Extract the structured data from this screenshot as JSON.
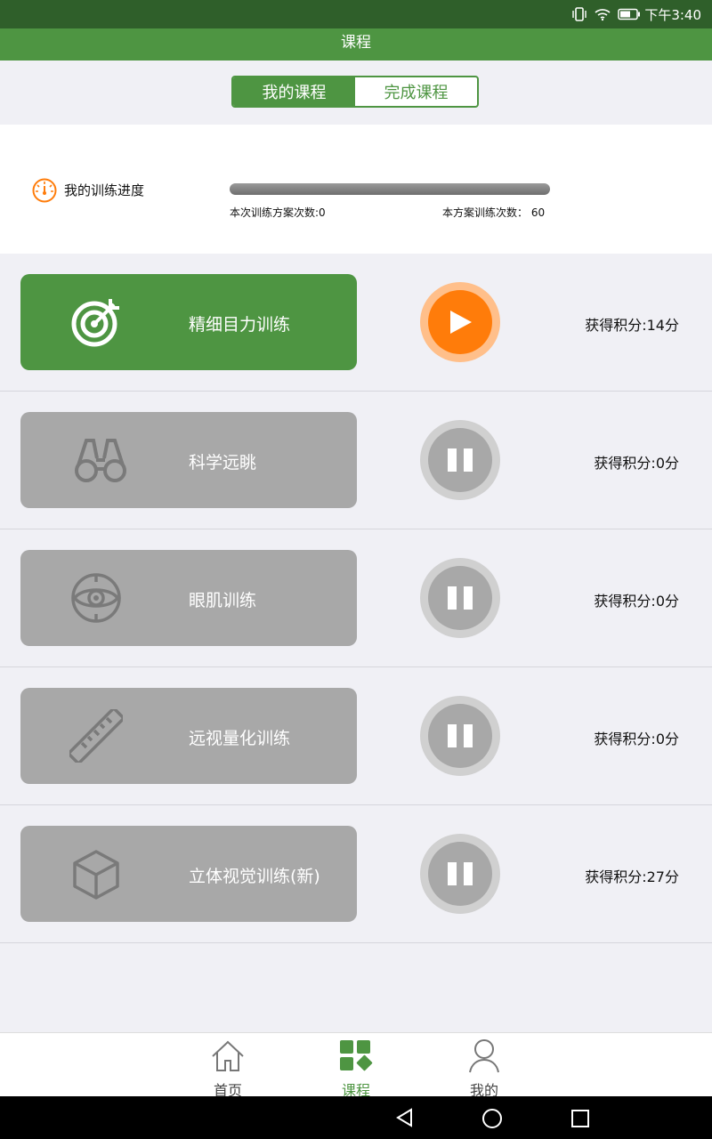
{
  "status_bar": {
    "time": "下午3:40"
  },
  "header": {
    "title": "课程"
  },
  "tabs": [
    {
      "label": "我的课程",
      "active": true
    },
    {
      "label": "完成课程",
      "active": false
    }
  ],
  "progress": {
    "label": "我的训练进度",
    "current_text": "本次训练方案次数:0",
    "total_text": "本方案训练次数：  60",
    "current": 0,
    "total": 60
  },
  "courses": [
    {
      "name": "精细目力训练",
      "icon": "target-icon",
      "score": "获得积分:14分",
      "state": "play"
    },
    {
      "name": "科学远眺",
      "icon": "binoculars-icon",
      "score": "获得积分:0分",
      "state": "pause"
    },
    {
      "name": "眼肌训练",
      "icon": "eye-target-icon",
      "score": "获得积分:0分",
      "state": "pause"
    },
    {
      "name": "远视量化训练",
      "icon": "ruler-icon",
      "score": "获得积分:0分",
      "state": "pause"
    },
    {
      "name": "立体视觉训练(新)",
      "icon": "cube-icon",
      "score": "获得积分:27分",
      "state": "pause"
    }
  ],
  "nav": [
    {
      "label": "首页",
      "icon": "home-icon",
      "active": false
    },
    {
      "label": "课程",
      "icon": "grid-icon",
      "active": true
    },
    {
      "label": "我的",
      "icon": "person-icon",
      "active": false
    }
  ],
  "colors": {
    "primary": "#4e9542",
    "accent": "#ff7c0a",
    "inactive": "#a8a8a8"
  }
}
